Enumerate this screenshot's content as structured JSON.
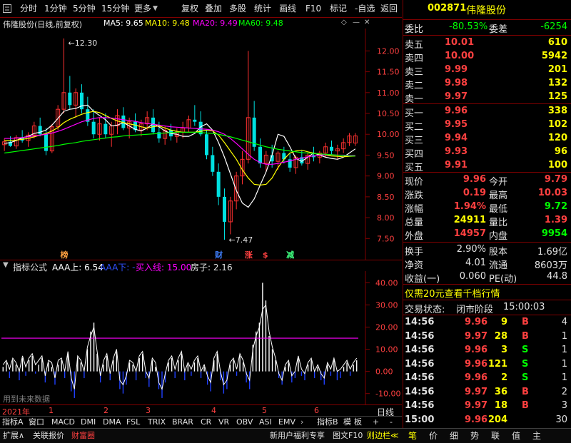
{
  "toolbar": {
    "menu_icon": "menu-square-icon",
    "left_items": [
      "分时",
      "1分钟",
      "5分钟",
      "15分钟",
      "更多"
    ],
    "right_items": [
      "复权",
      "叠加",
      "多股",
      "统计",
      "画线",
      "F10",
      "标记",
      "-自选",
      "返回"
    ]
  },
  "legend": {
    "title": "伟隆股份(日线,前复权)",
    "ma5": "MA5: 9.65",
    "ma10": "MA10: 9.48",
    "ma20": "MA20: 9.49",
    "ma60": "MA60: 9.48",
    "colors": {
      "ma5": "#ffffff",
      "ma10": "#ffff00",
      "ma20": "#ff00ff",
      "ma60": "#00ff00"
    }
  },
  "indicator_legend": {
    "title": "指标公式",
    "aaa_up": "AAA上: 6.54",
    "aaa_down": "AAA下: -",
    "buy_line": "买入线: 15.00",
    "house": "房子: 2.16"
  },
  "watermark": "用到未来数据",
  "chart_data": [
    {
      "type": "candlestick",
      "y_ticks": [
        "12.00",
        "11.50",
        "11.00",
        "10.50",
        "10.00",
        "9.50",
        "9.00",
        "8.50",
        "8.00",
        "7.50"
      ],
      "ylim": [
        7.3,
        12.4
      ],
      "annotations": {
        "high": "12.30",
        "low": "7.47"
      },
      "markers": [
        "榜",
        "财",
        "涨",
        "$",
        "减"
      ],
      "series": [
        {
          "name": "MA5",
          "color": "#ffffff",
          "values": [
            9.78,
            9.8,
            9.85,
            9.92,
            9.95,
            10.02,
            10.05,
            10.1,
            10.22,
            10.38,
            10.55,
            10.6,
            10.62,
            10.68,
            10.7,
            10.55,
            10.45,
            10.35,
            10.2,
            10.22,
            10.28,
            10.2,
            10.12,
            10.08,
            10.15,
            10.25,
            10.18,
            10.08,
            10.02,
            10.0,
            9.95,
            9.95,
            10.02,
            10.18,
            10.25,
            10.1,
            9.8,
            9.45,
            9.05,
            8.65,
            8.35,
            8.25,
            8.45,
            8.78,
            9.1,
            9.5,
            10.0,
            9.95,
            9.7,
            9.42,
            9.35,
            9.45,
            9.55,
            9.5,
            9.45,
            9.42,
            9.4,
            9.45,
            9.55,
            9.65
          ]
        },
        {
          "name": "MA10",
          "color": "#ffff00",
          "values": [
            9.85,
            9.85,
            9.86,
            9.88,
            9.9,
            9.94,
            9.98,
            10.02,
            10.08,
            10.16,
            10.28,
            10.36,
            10.42,
            10.48,
            10.52,
            10.55,
            10.52,
            10.45,
            10.38,
            10.32,
            10.28,
            10.25,
            10.22,
            10.18,
            10.15,
            10.18,
            10.2,
            10.15,
            10.1,
            10.07,
            10.05,
            10.05,
            10.05,
            10.07,
            10.1,
            10.08,
            9.98,
            9.8,
            9.6,
            9.4,
            9.15,
            8.95,
            8.8,
            8.78,
            8.8,
            8.95,
            9.2,
            9.4,
            9.55,
            9.6,
            9.62,
            9.58,
            9.55,
            9.52,
            9.5,
            9.48,
            9.47,
            9.46,
            9.47,
            9.48
          ]
        },
        {
          "name": "MA20",
          "color": "#ff00ff",
          "values": [
            9.9,
            9.9,
            9.91,
            9.92,
            9.94,
            9.96,
            9.98,
            10.0,
            10.03,
            10.07,
            10.12,
            10.18,
            10.24,
            10.3,
            10.34,
            10.38,
            10.4,
            10.4,
            10.39,
            10.37,
            10.35,
            10.33,
            10.31,
            10.28,
            10.26,
            10.24,
            10.22,
            10.2,
            10.18,
            10.17,
            10.16,
            10.15,
            10.14,
            10.13,
            10.12,
            10.1,
            10.06,
            10.0,
            9.9,
            9.78,
            9.65,
            9.52,
            9.4,
            9.32,
            9.28,
            9.28,
            9.3,
            9.33,
            9.36,
            9.4,
            9.43,
            9.46,
            9.48,
            9.5,
            9.51,
            9.51,
            9.5,
            9.5,
            9.49,
            9.49
          ]
        },
        {
          "name": "MA60",
          "color": "#00ff00",
          "values": [
            9.55,
            9.57,
            9.59,
            9.61,
            9.63,
            9.65,
            9.67,
            9.69,
            9.71,
            9.73,
            9.76,
            9.78,
            9.8,
            9.83,
            9.85,
            9.87,
            9.89,
            9.91,
            9.93,
            9.94,
            9.96,
            9.97,
            9.98,
            9.99,
            10.0,
            10.01,
            10.02,
            10.03,
            10.04,
            10.05,
            10.05,
            10.05,
            10.05,
            10.04,
            10.03,
            10.02,
            10.0,
            9.97,
            9.94,
            9.9,
            9.86,
            9.82,
            9.78,
            9.74,
            9.7,
            9.67,
            9.64,
            9.62,
            9.6,
            9.58,
            9.56,
            9.55,
            9.54,
            9.53,
            9.52,
            9.51,
            9.5,
            9.49,
            9.48,
            9.48
          ]
        }
      ],
      "candles": [
        [
          9.75,
          9.9,
          9.6,
          9.82
        ],
        [
          9.82,
          9.95,
          9.7,
          9.72
        ],
        [
          9.72,
          9.98,
          9.65,
          9.92
        ],
        [
          9.92,
          10.1,
          9.8,
          9.85
        ],
        [
          9.85,
          10.05,
          9.7,
          9.98
        ],
        [
          9.98,
          10.3,
          9.9,
          10.2
        ],
        [
          10.2,
          10.4,
          9.95,
          10.0
        ],
        [
          10.0,
          10.15,
          9.5,
          9.6
        ],
        [
          9.6,
          10.25,
          9.55,
          10.18
        ],
        [
          10.18,
          10.7,
          10.1,
          10.6
        ],
        [
          10.6,
          12.3,
          10.5,
          11.0
        ],
        [
          11.0,
          11.4,
          10.6,
          10.7
        ],
        [
          10.7,
          11.1,
          10.4,
          11.0
        ],
        [
          11.0,
          11.2,
          10.5,
          10.6
        ],
        [
          10.6,
          10.9,
          10.2,
          10.3
        ],
        [
          10.3,
          10.6,
          9.9,
          10.0
        ],
        [
          10.0,
          10.4,
          9.85,
          10.25
        ],
        [
          10.25,
          10.5,
          9.9,
          10.0
        ],
        [
          10.0,
          10.3,
          9.7,
          10.2
        ],
        [
          10.2,
          10.6,
          10.0,
          10.45
        ],
        [
          10.45,
          10.65,
          10.1,
          10.15
        ],
        [
          10.15,
          10.4,
          9.9,
          10.3
        ],
        [
          10.3,
          10.5,
          10.05,
          10.1
        ],
        [
          10.1,
          10.35,
          9.95,
          10.25
        ],
        [
          10.25,
          10.55,
          10.1,
          10.4
        ],
        [
          10.4,
          10.6,
          10.0,
          10.05
        ],
        [
          10.05,
          10.3,
          9.8,
          9.9
        ],
        [
          9.9,
          10.2,
          9.75,
          10.1
        ],
        [
          10.1,
          10.25,
          9.85,
          9.95
        ],
        [
          9.95,
          10.15,
          9.8,
          10.05
        ],
        [
          10.05,
          10.3,
          9.9,
          10.15
        ],
        [
          10.15,
          10.45,
          10.05,
          10.35
        ],
        [
          10.35,
          10.7,
          10.2,
          10.3
        ],
        [
          10.3,
          10.55,
          9.95,
          10.0
        ],
        [
          10.0,
          10.1,
          9.4,
          9.5
        ],
        [
          9.5,
          9.7,
          9.0,
          9.1
        ],
        [
          9.1,
          9.3,
          8.3,
          8.5
        ],
        [
          8.5,
          8.7,
          7.47,
          7.9
        ],
        [
          7.9,
          8.5,
          7.6,
          8.4
        ],
        [
          8.4,
          9.1,
          8.2,
          9.0
        ],
        [
          9.0,
          9.6,
          8.8,
          9.4
        ],
        [
          9.4,
          12.0,
          9.3,
          10.4
        ],
        [
          10.4,
          10.8,
          9.6,
          9.7
        ],
        [
          9.7,
          9.9,
          9.2,
          9.3
        ],
        [
          9.3,
          9.6,
          9.1,
          9.5
        ],
        [
          9.5,
          9.75,
          9.2,
          9.35
        ],
        [
          9.35,
          9.6,
          9.15,
          9.55
        ],
        [
          9.55,
          9.7,
          9.3,
          9.4
        ],
        [
          9.4,
          9.55,
          9.1,
          9.2
        ],
        [
          9.2,
          9.5,
          9.05,
          9.45
        ],
        [
          9.45,
          9.6,
          9.25,
          9.3
        ],
        [
          9.3,
          9.55,
          9.15,
          9.5
        ],
        [
          9.5,
          9.7,
          9.35,
          9.45
        ],
        [
          9.45,
          9.6,
          9.3,
          9.55
        ],
        [
          9.55,
          9.8,
          9.45,
          9.7
        ],
        [
          9.7,
          9.85,
          9.5,
          9.6
        ],
        [
          9.6,
          9.75,
          9.4,
          9.65
        ],
        [
          9.65,
          9.9,
          9.55,
          9.8
        ],
        [
          9.8,
          10.03,
          9.72,
          9.96
        ],
        [
          9.79,
          10.03,
          9.72,
          9.96
        ]
      ]
    },
    {
      "type": "bar",
      "y_ticks": [
        "40.00",
        "30.00",
        "20.00",
        "10.00",
        "0.00",
        "-10.00"
      ],
      "ylim": [
        -13,
        44
      ],
      "buy_line": 15.0,
      "values": [
        2,
        4,
        -3,
        5,
        3,
        -4,
        6,
        -2,
        5,
        7,
        -1,
        3,
        6,
        -5,
        4,
        2,
        -6,
        3,
        5,
        -3,
        8,
        -9,
        -12,
        6,
        4,
        -3,
        10,
        18,
        22,
        8,
        -5,
        3,
        7,
        -4,
        5,
        9,
        -8,
        -10,
        -6,
        4,
        3,
        -4,
        6,
        8,
        -3,
        -7,
        5,
        2,
        -8,
        -12,
        -5,
        4,
        6,
        -3,
        5,
        8,
        -4,
        3,
        -2,
        4,
        6,
        -3,
        2,
        -6,
        -9,
        5,
        8,
        -4,
        -10,
        -8,
        3,
        5,
        -2,
        7,
        4,
        -5,
        -8,
        12,
        18,
        22,
        40,
        32,
        16,
        10,
        5,
        -3,
        -6,
        2,
        4,
        -5,
        -3,
        6,
        -2,
        -4,
        3,
        5,
        -3,
        2,
        -4,
        -6,
        3,
        -2,
        5,
        -4,
        -3,
        2,
        4,
        -2,
        3,
        5
      ],
      "line": [
        3,
        5,
        1,
        6,
        4,
        0,
        7,
        2,
        6,
        8,
        3,
        5,
        7,
        -2,
        5,
        4,
        -3,
        5,
        6,
        0,
        9,
        -3,
        -8,
        7,
        5,
        0,
        11,
        16,
        20,
        9,
        -2,
        5,
        8,
        -1,
        6,
        10,
        -4,
        -6,
        -2,
        5,
        4,
        0,
        7,
        9,
        0,
        -3,
        6,
        4,
        -5,
        -8,
        -1,
        5,
        7,
        1,
        6,
        9,
        0,
        4,
        1,
        5,
        7,
        0,
        3,
        -2,
        -5,
        6,
        9,
        0,
        -6,
        -4,
        4,
        6,
        1,
        8,
        5,
        -1,
        -4,
        10,
        16,
        20,
        28,
        30,
        18,
        11,
        6,
        -1,
        -4,
        3,
        5,
        -2,
        0,
        7,
        1,
        -1,
        4,
        6,
        0,
        3,
        -1,
        -3,
        4,
        1,
        6,
        0,
        1,
        3,
        5,
        1,
        4,
        6
      ]
    }
  ],
  "timeline": {
    "year": "2021年",
    "months": [
      "1",
      "2",
      "3",
      "4",
      "5",
      "6"
    ],
    "right_label": "日线"
  },
  "indicator_tabs": [
    "指标A",
    "窗口",
    "MACD",
    "DMI",
    "DMA",
    "FSL",
    "TRIX",
    "BRAR",
    "CR",
    "VR",
    "OBV",
    "ASI",
    "EMV"
  ],
  "indicator_tabs_right": [
    "指标B",
    "模",
    "板",
    "+",
    "-"
  ],
  "bottom_bar": {
    "left": [
      "扩展∧",
      "关联报价",
      "财富圈"
    ],
    "right": [
      "新用户福利专享",
      "图文F10",
      "则边栏≪"
    ],
    "side_tabs": [
      "笔",
      "价",
      "细",
      "势",
      "联",
      "值",
      "主"
    ]
  },
  "quote": {
    "code": "002871",
    "name": "伟隆股份",
    "weibi_label": "委比",
    "weibi": "-80.53%",
    "weicha_label": "委差",
    "weicha": "-6254",
    "asks": [
      {
        "label": "卖五",
        "price": "10.01",
        "vol": "610"
      },
      {
        "label": "卖四",
        "price": "10.00",
        "vol": "5942"
      },
      {
        "label": "卖三",
        "price": "9.99",
        "vol": "201"
      },
      {
        "label": "卖二",
        "price": "9.98",
        "vol": "132"
      },
      {
        "label": "卖一",
        "price": "9.97",
        "vol": "125"
      }
    ],
    "bids": [
      {
        "label": "买一",
        "price": "9.96",
        "vol": "338"
      },
      {
        "label": "买二",
        "price": "9.95",
        "vol": "102"
      },
      {
        "label": "买三",
        "price": "9.94",
        "vol": "120"
      },
      {
        "label": "买四",
        "price": "9.93",
        "vol": "96"
      },
      {
        "label": "买五",
        "price": "9.91",
        "vol": "100"
      }
    ],
    "stats": [
      {
        "l1": "现价",
        "v1": "9.96",
        "l2": "今开",
        "v2": "9.79",
        "c1": "#ff4040",
        "c2": "#ff4040"
      },
      {
        "l1": "涨跌",
        "v1": "0.19",
        "l2": "最高",
        "v2": "10.03",
        "c1": "#ff4040",
        "c2": "#ff4040"
      },
      {
        "l1": "涨幅",
        "v1": "1.94%",
        "l2": "最低",
        "v2": "9.72",
        "c1": "#ff4040",
        "c2": "#00ff00"
      },
      {
        "l1": "总量",
        "v1": "24911",
        "l2": "量比",
        "v2": "1.39",
        "c1": "#ffff00",
        "c2": "#ff4040"
      },
      {
        "l1": "外盘",
        "v1": "14957",
        "l2": "内盘",
        "v2": "9954",
        "c1": "#ff4040",
        "c2": "#00ff00"
      }
    ],
    "stats2": [
      {
        "l1": "换手",
        "v1": "2.90%",
        "l2": "股本",
        "v2": "1.69亿"
      },
      {
        "l1": "净资",
        "v1": "4.01",
        "l2": "流通",
        "v2": "8603万"
      },
      {
        "l1": "收益(一)",
        "v1": "0.060",
        "l2": "PE(动)",
        "v2": "44.8"
      }
    ],
    "promo": "仅需20元查看千档行情",
    "trade_status_label": "交易状态:",
    "trade_status": "闭市阶段",
    "trade_time": "15:00:03",
    "ticks": [
      {
        "t": "14:56",
        "p": "9.96",
        "v": "9",
        "s": "B"
      },
      {
        "t": "14:56",
        "p": "9.97",
        "v": "28",
        "s": "B"
      },
      {
        "t": "14:56",
        "p": "9.96",
        "v": "3",
        "s": "S"
      },
      {
        "t": "14:56",
        "p": "9.96",
        "v": "121",
        "s": "S"
      },
      {
        "t": "14:56",
        "p": "9.96",
        "v": "2",
        "s": "S"
      },
      {
        "t": "14:56",
        "p": "9.97",
        "v": "36",
        "s": "B"
      },
      {
        "t": "14:56",
        "p": "9.97",
        "v": "18",
        "s": "B"
      },
      {
        "t": "15:00",
        "p": "9.96",
        "v": "204",
        "s": ""
      }
    ],
    "tick_nums": [
      "4",
      "1",
      "1",
      "1",
      "1",
      "2",
      "3",
      "30"
    ]
  }
}
